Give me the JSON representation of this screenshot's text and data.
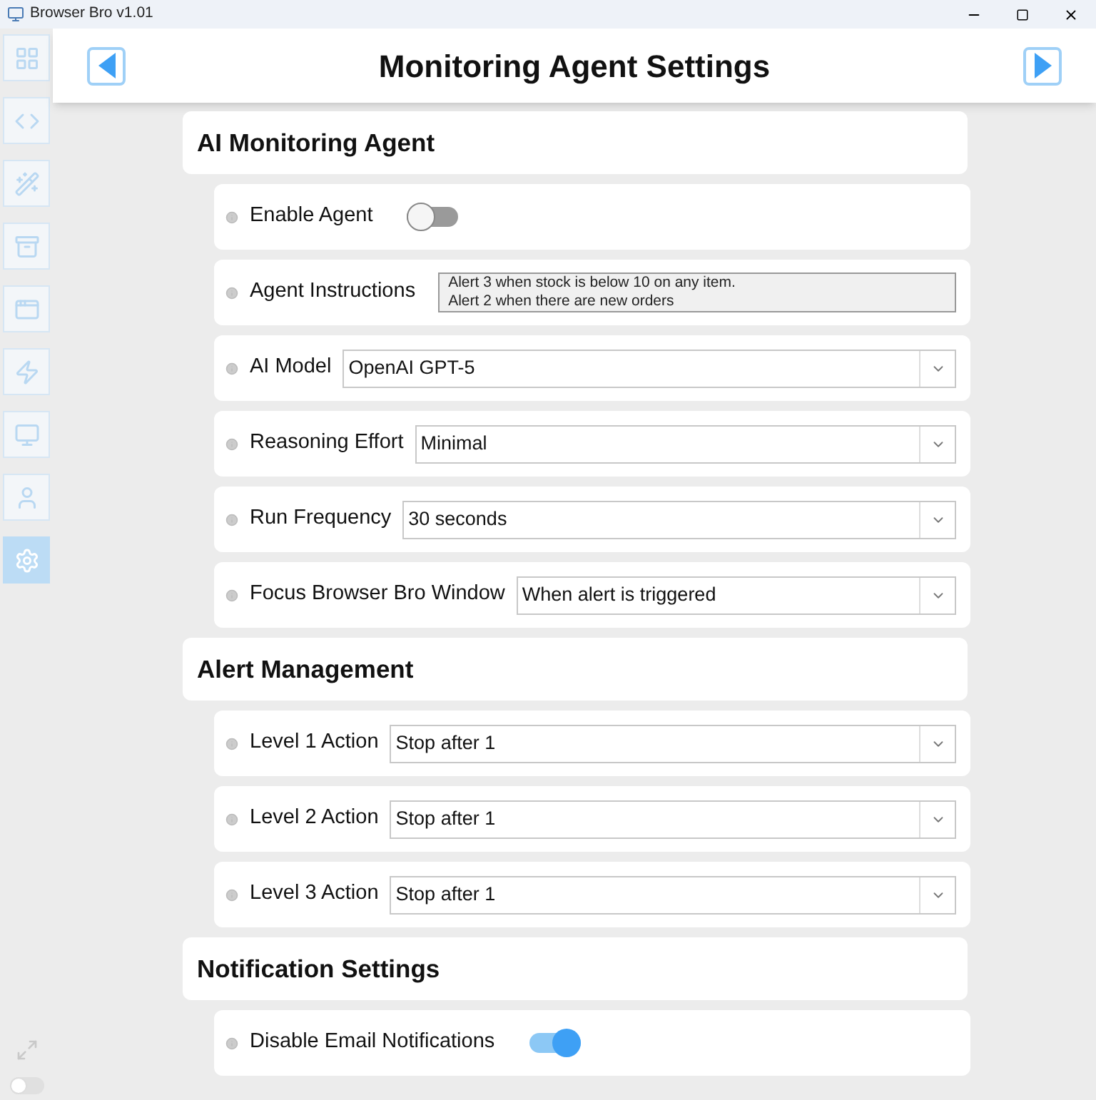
{
  "window": {
    "title": "Browser Bro v1.01"
  },
  "header": {
    "title": "Monitoring Agent Settings"
  },
  "sidebar": {
    "items": [
      {
        "selected": false
      },
      {
        "selected": false
      },
      {
        "selected": false
      },
      {
        "selected": false
      },
      {
        "selected": false
      },
      {
        "selected": false
      },
      {
        "selected": false
      },
      {
        "selected": false
      },
      {
        "selected": true
      }
    ],
    "bottom_toggle": {
      "on": false
    }
  },
  "sections": [
    {
      "title": "AI Monitoring Agent",
      "rows": [
        {
          "kind": "toggle",
          "label": "Enable Agent",
          "on": false
        },
        {
          "kind": "textarea",
          "label": "Agent Instructions",
          "lines": [
            "Alert 3 when stock is below 10 on any item.",
            "Alert 2 when there are new orders"
          ]
        },
        {
          "kind": "select",
          "label": "AI Model",
          "value": "OpenAI GPT-5"
        },
        {
          "kind": "select",
          "label": "Reasoning Effort",
          "value": "Minimal"
        },
        {
          "kind": "select",
          "label": "Run Frequency",
          "value": "30 seconds"
        },
        {
          "kind": "select",
          "label": "Focus Browser Bro Window",
          "value": "When alert is triggered"
        }
      ]
    },
    {
      "title": "Alert Management",
      "rows": [
        {
          "kind": "select",
          "label": "Level 1 Action",
          "value": "Stop after 1"
        },
        {
          "kind": "select",
          "label": "Level 2 Action",
          "value": "Stop after 1"
        },
        {
          "kind": "select",
          "label": "Level 3 Action",
          "value": "Stop after 1"
        }
      ]
    },
    {
      "title": "Notification Settings",
      "rows": [
        {
          "kind": "toggle",
          "label": "Disable Email Notifications",
          "on": true
        }
      ]
    }
  ]
}
